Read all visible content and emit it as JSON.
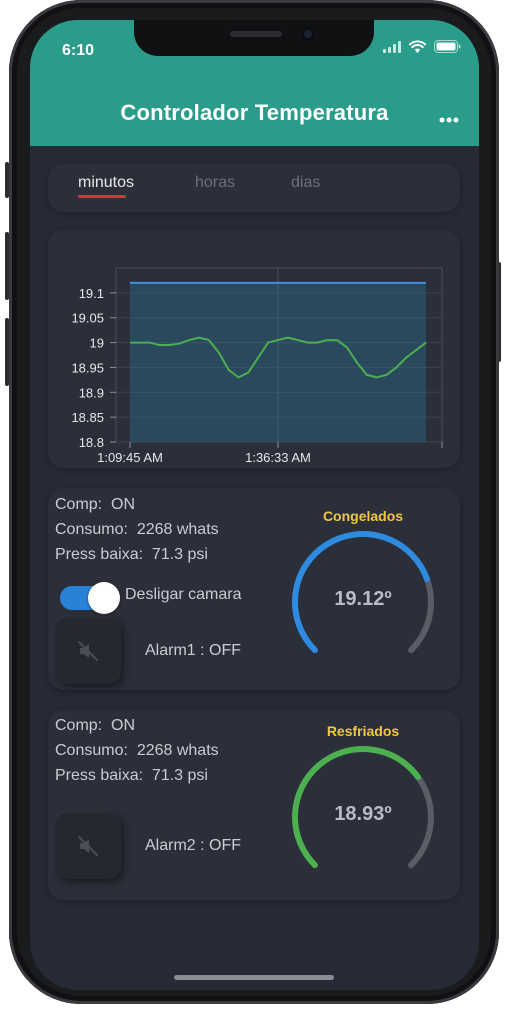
{
  "status_bar": {
    "time": "6:10"
  },
  "app_bar": {
    "title": "Controlador Temperatura"
  },
  "tabs": [
    {
      "label": "minutos",
      "active": true
    },
    {
      "label": "horas",
      "active": false
    },
    {
      "label": "dias",
      "active": false
    }
  ],
  "chart_data": {
    "type": "area",
    "x_tick_labels": [
      "1:09:45 AM",
      "1:36:33 AM"
    ],
    "y_tick_labels": [
      "19.1",
      "19.05",
      "19",
      "18.95",
      "18.9",
      "18.85",
      "18.8"
    ],
    "ylim": [
      18.8,
      19.15
    ],
    "grid": true,
    "series": [
      {
        "color": "#3d8fe0",
        "values": [
          19.12,
          19.12,
          19.12,
          19.12,
          19.12,
          19.12,
          19.12,
          19.12,
          19.12,
          19.12,
          19.12,
          19.12,
          19.12,
          19.12,
          19.12,
          19.12,
          19.12,
          19.12,
          19.12,
          19.12,
          19.12,
          19.12,
          19.12,
          19.12,
          19.12,
          19.12,
          19.12,
          19.12,
          19.12,
          19.12,
          19.12
        ]
      },
      {
        "color": "#4caf50",
        "values": [
          19.0,
          19.0,
          19.0,
          18.995,
          18.995,
          18.998,
          19.005,
          19.01,
          19.005,
          18.98,
          18.945,
          18.93,
          18.94,
          18.97,
          19.0,
          19.005,
          19.01,
          19.005,
          19.0,
          19.0,
          19.005,
          19.005,
          18.99,
          18.96,
          18.935,
          18.93,
          18.935,
          18.95,
          18.97,
          18.985,
          19.0
        ]
      }
    ]
  },
  "units": [
    {
      "comp": "Comp:  ON",
      "consumo": "Consumo:  2268 whats",
      "press": "Press baixa:  71.3 psi",
      "toggle_label": "Desligar camara",
      "toggle_on": true,
      "alarm": "Alarm1 : OFF",
      "gauge_title": "Congelados",
      "gauge_value": "19.12º",
      "gauge_fraction": 0.76,
      "gauge_color": "#2e8be0"
    },
    {
      "comp": "Comp:  ON",
      "consumo": "Consumo:  2268 whats",
      "press": "Press baixa:  71.3 psi",
      "alarm": "Alarm2 : OFF",
      "gauge_title": "Resfriados",
      "gauge_value": "18.93º",
      "gauge_fraction": 0.7,
      "gauge_color": "#4caf50"
    }
  ],
  "icons": {
    "signal": "signal-icon",
    "wifi": "wifi-icon",
    "battery": "battery-icon",
    "more": "more-horizontal-icon",
    "mute": "volume-mute-icon"
  }
}
